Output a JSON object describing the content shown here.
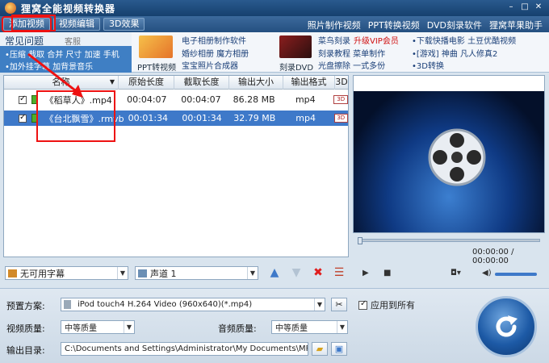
{
  "app": {
    "title": "狸窝全能视频转换器"
  },
  "toolbar": {
    "tabs": [
      "添加视频",
      "视频编辑",
      "3D效果"
    ]
  },
  "top_links": [
    "照片制作视频",
    "PPT转换视频",
    "DVD刻录软件",
    "狸窝苹果助手"
  ],
  "faq": {
    "title": "常见问题",
    "qq": "客服qq876292449",
    "line1": "•压缩  截取  合并  尺寸  加速  手机",
    "line2": "•加外挂字幕  加背景音乐"
  },
  "promo": {
    "ppt_caption": "PPT转视频",
    "block2": [
      "电子相册制作软件",
      "婚纱相册  魔方相册",
      "宝宝照片合成器"
    ],
    "dvd_caption": "刻录DVD",
    "block3": [
      "菜鸟刻录",
      "升级VIP会员",
      "刻录教程  菜单制作",
      "光盘擦除  一式多份"
    ],
    "block4": [
      "•下载快播电影  土豆优酷视频",
      "•[游戏]  神曲  凡人修真2",
      "•3D转换"
    ]
  },
  "list": {
    "headers": {
      "name": "名称",
      "duration": "原始长度",
      "cut": "截取长度",
      "size": "输出大小",
      "format": "输出格式",
      "three_d": "3D"
    },
    "rows": [
      {
        "name": "《稻草人》.mp4",
        "duration": "00:04:07",
        "cut": "00:04:07",
        "size": "86.28 MB",
        "format": "mp4",
        "badge": "3D"
      },
      {
        "name": "《台北飘雪》.rmvb",
        "duration": "00:01:34",
        "cut": "00:01:34",
        "size": "32.79 MB",
        "format": "mp4",
        "badge": "3D"
      }
    ]
  },
  "subtitle_select": "无可用字幕",
  "audio_select": "声道 1",
  "player": {
    "timecode": "00:00:00 / 00:00:00"
  },
  "settings": {
    "preset_label": "预置方案:",
    "preset_value": "iPod touch4 H.264 Video (960x640)(*.mp4)",
    "apply_all": "应用到所有",
    "video_quality_label": "视频质量:",
    "video_quality": "中等质量",
    "audio_quality_label": "音频质量:",
    "audio_quality": "中等质量",
    "output_label": "输出目录:",
    "output_path": "C:\\Documents and Settings\\Administrator\\My Documents\\MP4"
  },
  "colors": {
    "accent": "#3e79c9",
    "highlight": "#e11111",
    "titlebar": "#16406e"
  }
}
